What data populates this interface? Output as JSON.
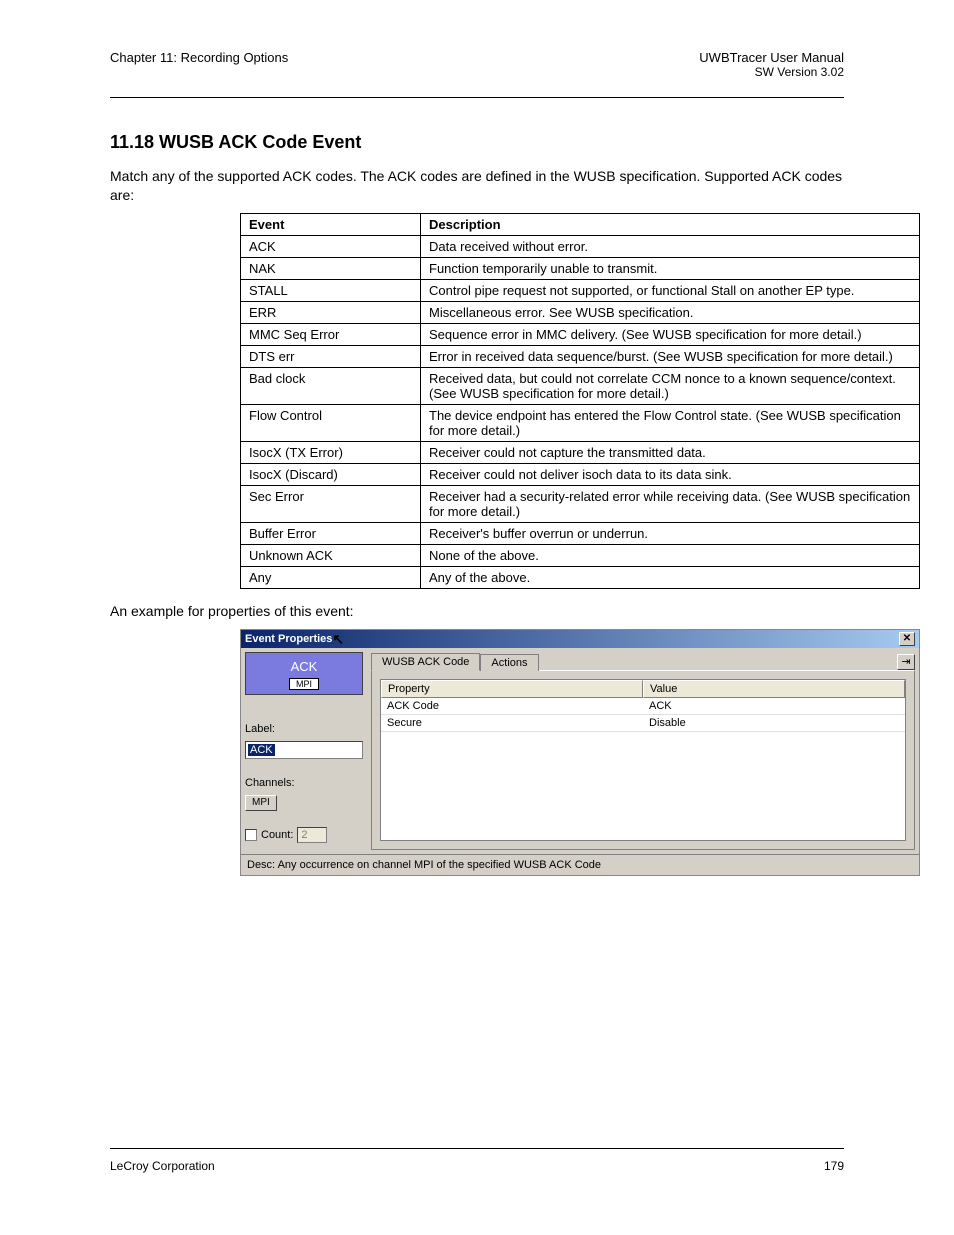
{
  "header": {
    "left": "Chapter 11: Recording Options",
    "right": "UWBTracer User Manual",
    "version": "SW Version 3.02"
  },
  "heading": "11.18 WUSB ACK Code Event",
  "intro": "Match any of the supported ACK codes. The ACK codes are defined in the WUSB specification. Supported ACK codes are:",
  "table": {
    "header": [
      "Event",
      "Description"
    ],
    "rows": [
      [
        "ACK",
        "Data received without error."
      ],
      [
        "NAK",
        "Function temporarily unable to transmit."
      ],
      [
        "STALL",
        "Control pipe request not supported, or functional Stall on another EP type."
      ],
      [
        "ERR",
        "Miscellaneous error. See WUSB specification."
      ],
      [
        "MMC Seq Error",
        "Sequence error in MMC delivery. (See WUSB specification for more detail.)"
      ],
      [
        "DTS err",
        "Error in received data sequence/burst. (See WUSB specification for more detail.)"
      ],
      [
        "Bad clock",
        "Received data, but could not correlate CCM nonce to a known sequence/context. (See WUSB specification for more detail.)"
      ],
      [
        "Flow Control",
        "The device endpoint has entered the Flow Control state. (See WUSB specification for more detail.)"
      ],
      [
        "IsocX (TX Error)",
        "Receiver could not capture the transmitted data."
      ],
      [
        "IsocX (Discard)",
        "Receiver could not deliver isoch data to its data sink."
      ],
      [
        "Sec Error",
        "Receiver had a security-related error while receiving data. (See WUSB specification for more detail.)"
      ],
      [
        "Buffer Error",
        "Receiver's buffer overrun or underrun."
      ],
      [
        "Unknown ACK",
        "None of the above."
      ],
      [
        "Any",
        "Any of the above."
      ]
    ]
  },
  "post_table": "An example for properties of this event:",
  "dialog": {
    "title": "Event Properties",
    "ack_label": "ACK",
    "badge": "MPI",
    "label_label": "Label:",
    "label_value": "ACK",
    "channels_label": "Channels:",
    "channels_button": "MPI",
    "count_label": "Count:",
    "count_value": "2",
    "tabs": [
      "WUSB ACK Code",
      "Actions"
    ],
    "prop_header": [
      "Property",
      "Value"
    ],
    "prop_rows": [
      [
        "ACK Code",
        "ACK"
      ],
      [
        "Secure",
        "Disable"
      ]
    ],
    "status_prefix": "Desc: ",
    "status": "Any occurrence on channel MPI of the specified WUSB ACK Code"
  },
  "footer": {
    "left": "LeCroy Corporation",
    "right": "179"
  }
}
